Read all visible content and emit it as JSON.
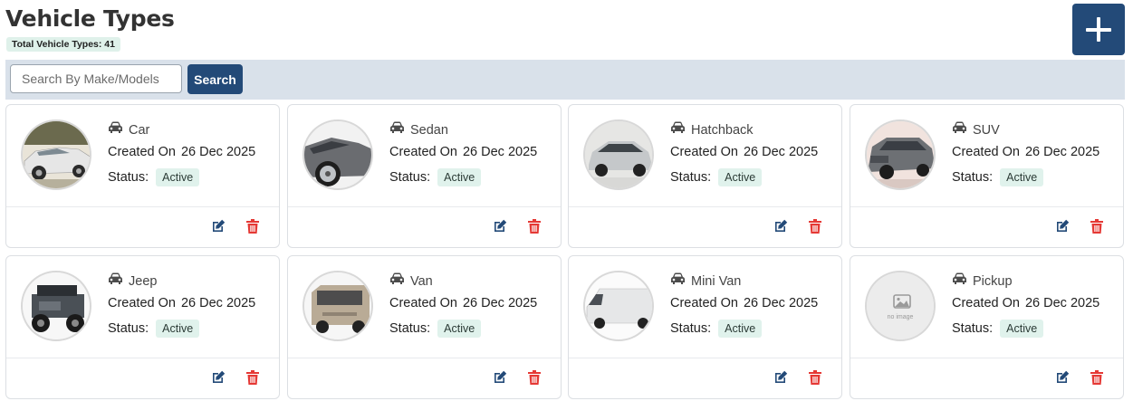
{
  "header": {
    "title": "Vehicle Types",
    "total_label": "Total Vehicle Types: 41",
    "add_button_icon": "plus-icon"
  },
  "search": {
    "placeholder": "Search By Make/Models",
    "value": "",
    "button_label": "Search"
  },
  "card_labels": {
    "created_prefix": "Created On",
    "status_prefix": "Status:"
  },
  "colors": {
    "primary": "#234a78",
    "delete": "#e53935",
    "badge_bg": "#e0f2ec"
  },
  "cards": [
    {
      "name": "Car",
      "created": "26 Dec 2025",
      "status": "Active",
      "image": "car"
    },
    {
      "name": "Sedan",
      "created": "26 Dec 2025",
      "status": "Active",
      "image": "sedan"
    },
    {
      "name": "Hatchback",
      "created": "26 Dec 2025",
      "status": "Active",
      "image": "hatchback"
    },
    {
      "name": "SUV",
      "created": "26 Dec 2025",
      "status": "Active",
      "image": "suv"
    },
    {
      "name": "Jeep",
      "created": "26 Dec 2025",
      "status": "Active",
      "image": "jeep"
    },
    {
      "name": "Van",
      "created": "26 Dec 2025",
      "status": "Active",
      "image": "van"
    },
    {
      "name": "Mini Van",
      "created": "26 Dec 2025",
      "status": "Active",
      "image": "minivan"
    },
    {
      "name": "Pickup",
      "created": "26 Dec 2025",
      "status": "Active",
      "image": "no-image",
      "placeholder_text": "no image"
    }
  ]
}
